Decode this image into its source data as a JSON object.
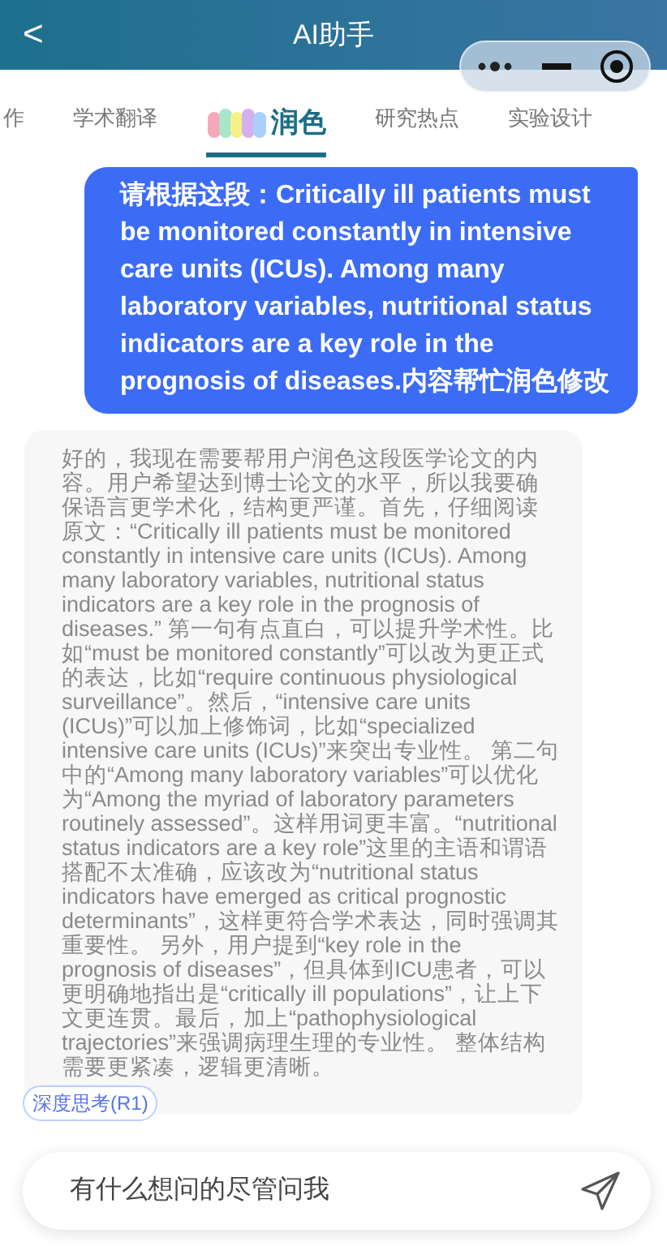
{
  "header": {
    "title": "AI助手",
    "back": "<"
  },
  "tabs": [
    {
      "label": "作",
      "selected": false,
      "icon": false
    },
    {
      "label": "学术翻译",
      "selected": false,
      "icon": false
    },
    {
      "label": "润色",
      "selected": true,
      "icon": true
    },
    {
      "label": "研究热点",
      "selected": false,
      "icon": false
    },
    {
      "label": "实验设计",
      "selected": false,
      "icon": false
    }
  ],
  "messages": [
    {
      "kind": "user",
      "text": "请根据这段：Critically ill patients must be monitored constantly in intensive care units (ICUs). Among many laboratory variables, nutritional status indicators are a key role in the prognosis of diseases.内容帮忙润色修改"
    },
    {
      "kind": "reasoning",
      "text": "好的，我现在需要帮用户润色这段医学论文的内容。用户希望达到博士论文的水平，所以我要确保语言更学术化，结构更严谨。首先，仔细阅读原文：“Critically ill patients must be monitored constantly in intensive care units (ICUs). Among many laboratory variables, nutritional status indicators are a key role in the prognosis of diseases.” 第一句有点直白，可以提升学术性。比如“must be monitored constantly”可以改为更正式的表达，比如“require continuous physiological surveillance”。然后，“intensive care units (ICUs)”可以加上修饰词，比如“specialized intensive care units (ICUs)”来突出专业性。 第二句中的“Among many laboratory variables”可以优化为“Among the myriad of laboratory parameters routinely assessed”。这样用词更丰富。“nutritional status indicators are a key role”这里的主语和谓语搭配不太准确，应该改为“nutritional status indicators have emerged as critical prognostic determinants”，这样更符合学术表达，同时强调其重要性。 另外，用户提到“key role in the prognosis of diseases”，但具体到ICU患者，可以更明确地指出是“critically ill populations”，让上下文更连贯。最后，加上“pathophysiological trajectories”来强调病理生理的专业性。 整体结构需要更紧凑，逻辑更清晰。",
      "badge": "深度思考(R1)"
    }
  ],
  "input": {
    "placeholder": "有什么想问的尽管问我"
  }
}
